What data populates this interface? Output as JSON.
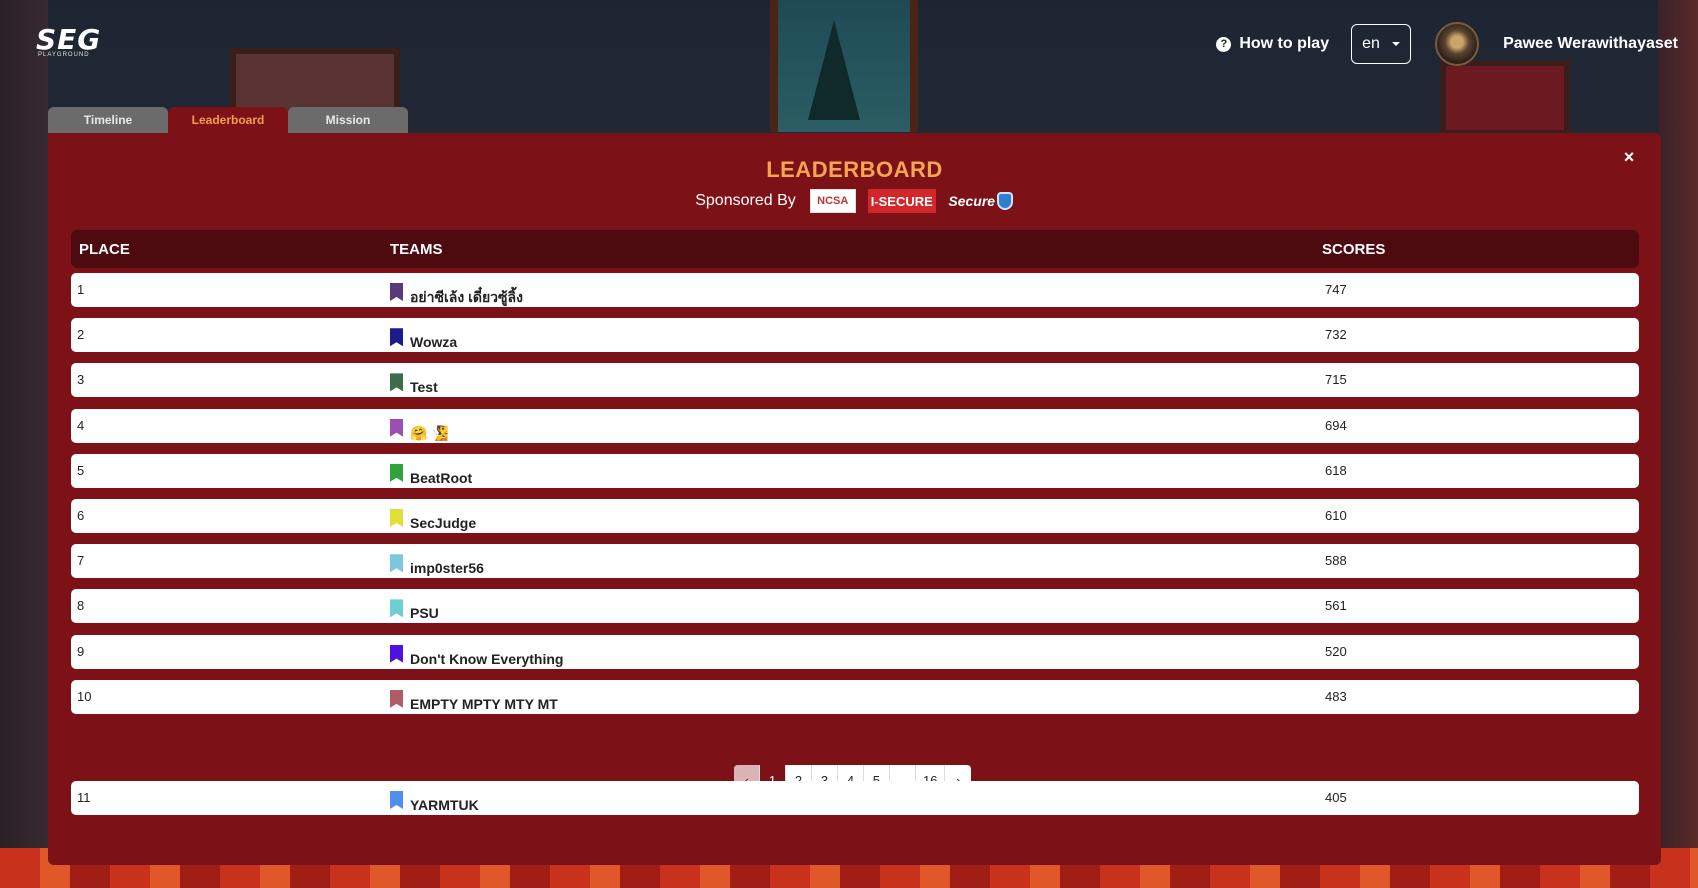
{
  "header": {
    "logo_text": "SEG",
    "logo_sub": "PLAYGROUND",
    "how_to_play": "How to play",
    "language": "en",
    "username": "Pawee Werawithayaset"
  },
  "tabs": [
    {
      "label": "Timeline",
      "active": false
    },
    {
      "label": "Leaderboard",
      "active": true
    },
    {
      "label": "Mission",
      "active": false
    }
  ],
  "leaderboard": {
    "title": "LEADERBOARD",
    "sponsored_by": "Sponsored By",
    "sponsors": [
      "NCSA",
      "I-SECURE",
      "Secure"
    ],
    "close": "×",
    "columns": {
      "place": "PLACE",
      "teams": "TEAMS",
      "scores": "SCORES"
    },
    "rows": [
      {
        "place": "1",
        "team": "อย่าซีเล้ง เดี๋ยวซู้ลิ้ง",
        "score": "747",
        "flag_color": "#5b3a7a"
      },
      {
        "place": "2",
        "team": "Wowza",
        "score": "732",
        "flag_color": "#1d1b8a"
      },
      {
        "place": "3",
        "team": "Test",
        "score": "715",
        "flag_color": "#3f6b4a"
      },
      {
        "place": "4",
        "team": "🤗 🧏",
        "score": "694",
        "flag_color": "#9b4fb5"
      },
      {
        "place": "5",
        "team": "BeatRoot",
        "score": "618",
        "flag_color": "#2fa43c"
      },
      {
        "place": "6",
        "team": "SecJudge",
        "score": "610",
        "flag_color": "#e3df3a"
      },
      {
        "place": "7",
        "team": "imp0ster56",
        "score": "588",
        "flag_color": "#7ec6e0"
      },
      {
        "place": "8",
        "team": "PSU",
        "score": "561",
        "flag_color": "#6ecfd2"
      },
      {
        "place": "9",
        "team": "Don't Know Everything",
        "score": "520",
        "flag_color": "#4b12e0"
      },
      {
        "place": "10",
        "team": "EMPTY MPTY MTY MT",
        "score": "483",
        "flag_color": "#b05b66"
      }
    ],
    "pagination": [
      "‹",
      "1",
      "2",
      "3",
      "4",
      "5",
      "...",
      "16",
      "›"
    ],
    "current_page": "1",
    "own_row": {
      "place": "11",
      "team": "YARMTUK",
      "score": "405",
      "flag_color": "#4f8ff0"
    }
  },
  "colors": {
    "panel": "#7c1217",
    "header_row": "#4d0b10",
    "title": "#f3a552"
  }
}
